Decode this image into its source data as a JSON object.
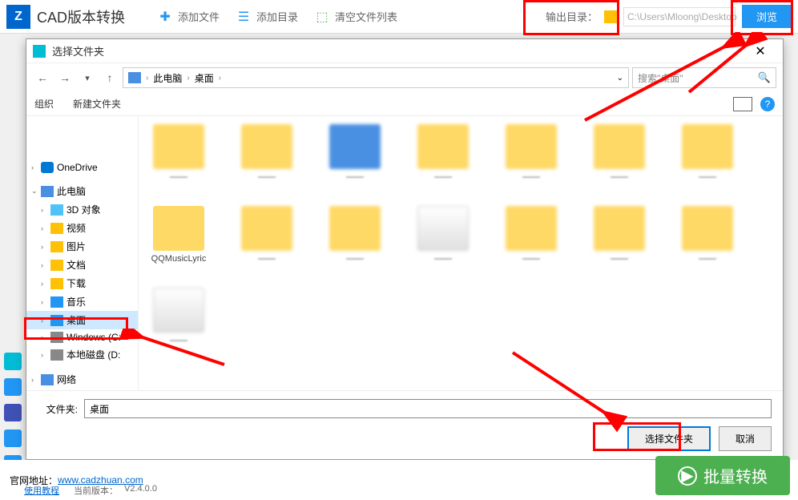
{
  "app": {
    "title": "CAD版本转换",
    "toolbar": {
      "add_file": "添加文件",
      "add_dir": "添加目录",
      "clear_list": "清空文件列表",
      "output_label": "输出目录：",
      "output_path": "C:\\Users\\Mloong\\Desktop",
      "browse": "浏览"
    },
    "footer": {
      "site_label": "官网地址：",
      "site_url": "www.cadzhuan.com",
      "tutorial": "使用教程",
      "version_label": "当前版本：",
      "version": "V2.4.0.0",
      "batch_convert": "批量转换"
    }
  },
  "dialog": {
    "title": "选择文件夹",
    "breadcrumb": {
      "pc": "此电脑",
      "desktop": "桌面"
    },
    "search_placeholder": "搜索\"桌面\"",
    "toolbar": {
      "organize": "组织",
      "new_folder": "新建文件夹"
    },
    "tree": {
      "onedrive": "OneDrive",
      "this_pc": "此电脑",
      "obj3d": "3D 对象",
      "videos": "视频",
      "pictures": "图片",
      "documents": "文档",
      "downloads": "下载",
      "music": "音乐",
      "desktop": "桌面",
      "windows_c": "Windows (C:",
      "local_d": "本地磁盘 (D:",
      "network": "网络"
    },
    "files": {
      "qqmusic": "QQMusicLyric"
    },
    "folder_label": "文件夹:",
    "folder_value": "桌面",
    "select_btn": "选择文件夹",
    "cancel_btn": "取消"
  }
}
